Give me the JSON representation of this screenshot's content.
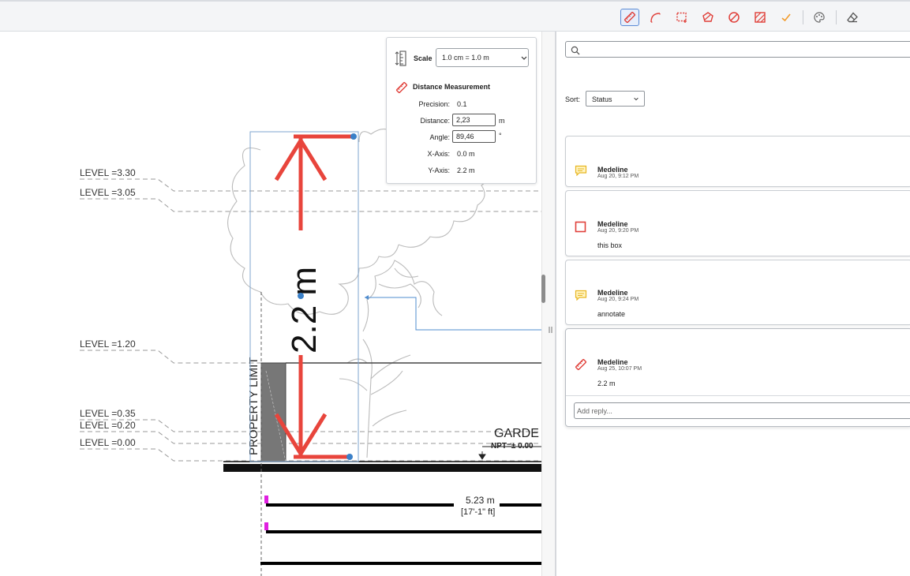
{
  "toolbar": {
    "tools": [
      {
        "name": "ruler-tool",
        "label": "Distance"
      },
      {
        "name": "arc-tool",
        "label": "Arc"
      },
      {
        "name": "rect-area-tool",
        "label": "Area"
      },
      {
        "name": "polygon-tool",
        "label": "Polygon"
      },
      {
        "name": "no-tool",
        "label": "Exclusion"
      },
      {
        "name": "hatch-tool",
        "label": "Hatch"
      },
      {
        "name": "check-tool",
        "label": "Check"
      },
      {
        "name": "palette-tool",
        "label": "Color"
      },
      {
        "name": "eraser-tool",
        "label": "Eraser"
      }
    ],
    "accent": "#e0403a",
    "active_color": "#5b8bd6"
  },
  "drawing": {
    "levels": [
      "LEVEL =3.30",
      "LEVEL =3.05",
      "LEVEL =1.20",
      "LEVEL =0.35",
      "LEVEL =0.20",
      "LEVEL =0.00"
    ],
    "property_limit": "PROPERTY LIMIT",
    "garden_label": "GARDE",
    "npt_label": "NPT=± 0.00",
    "measurement_label": "2.2 m",
    "dimension_metric": "5.23 m",
    "dimension_imperial": "[17'-1\" ft]"
  },
  "measure_panel": {
    "scale_label": "Scale",
    "scale_value": "1.0 cm = 1.0 m",
    "title": "Distance Measurement",
    "precision_label": "Precision:",
    "precision_value": "0.1",
    "distance_label": "Distance:",
    "distance_value": "2,23",
    "distance_unit": "m",
    "angle_label": "Angle:",
    "angle_value": "89,46",
    "angle_unit": "°",
    "xaxis_label": "X-Axis:",
    "xaxis_value": "0.0 m",
    "yaxis_label": "Y-Axis:",
    "yaxis_value": "2.2 m"
  },
  "right_pane": {
    "search_placeholder": "",
    "sort_label": "Sort:",
    "sort_value": "Status",
    "comments": [
      {
        "author": "Medeline",
        "time": "Aug 20, 9:12 PM",
        "body": "",
        "icon": "comment-icon"
      },
      {
        "author": "Medeline",
        "time": "Aug 20, 9:20 PM",
        "body": "this box",
        "icon": "rectangle-icon"
      },
      {
        "author": "Medeline",
        "time": "Aug 20, 9:24 PM",
        "body": "annotate",
        "icon": "comment-icon"
      },
      {
        "author": "Medeline",
        "time": "Aug 25, 10:07 PM",
        "body": "2.2 m",
        "icon": "ruler-icon"
      }
    ],
    "reply_placeholder": "Add reply..."
  }
}
